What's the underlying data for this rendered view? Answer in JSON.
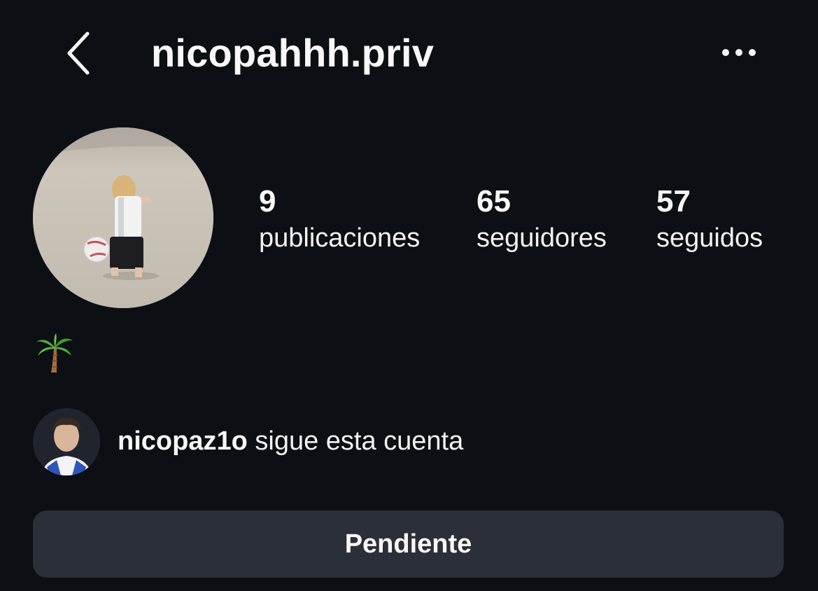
{
  "header": {
    "username": "nicopahhh.priv",
    "back_icon": "chevron-left-icon",
    "more_icon": "more-horizontal-icon"
  },
  "profile": {
    "avatar_description": "profile-photo",
    "stats": [
      {
        "value": "9",
        "label": "publicaciones"
      },
      {
        "value": "65",
        "label": "seguidores"
      },
      {
        "value": "57",
        "label": "seguidos"
      }
    ],
    "bio_icon": "palm-tree-icon"
  },
  "followed_by": {
    "username": "nicopaz1o",
    "text": " sigue esta cuenta"
  },
  "actions": {
    "follow_status_label": "Pendiente"
  },
  "colors": {
    "background": "#0c0f14",
    "button": "#2b2f37",
    "text": "#f7f7f7"
  }
}
